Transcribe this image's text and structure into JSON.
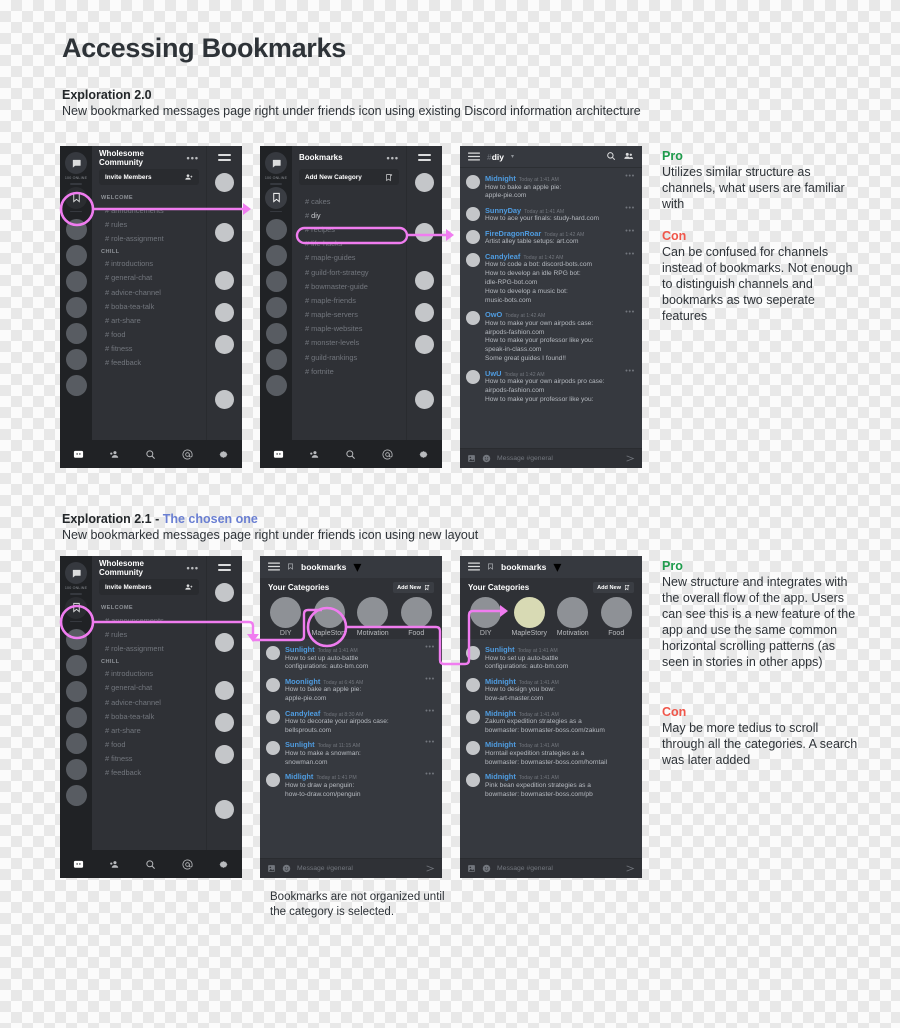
{
  "title": "Accessing Bookmarks",
  "explorations": [
    {
      "heading": "Exploration 2.0",
      "subtitle": "New bookmarked messages page right under friends icon using existing Discord information architecture",
      "pro_label": "Pro",
      "pro_text": "Utilizes similar structure as channels, what users are familiar with",
      "con_label": "Con",
      "con_text": "Can be confused for channels instead of bookmarks. Not enough to distinguish channels and bookmarks as two seperate features"
    },
    {
      "heading": "Exploration 2.1 - ",
      "heading_accent": "The chosen one",
      "subtitle": "New bookmarked messages page right under friends icon using new layout",
      "pro_label": "Pro",
      "pro_text": "New structure and integrates with the overall flow of the app. Users can see this is a new feature of the app and use the same common horizontal scrolling patterns (as seen in stories in other apps)",
      "con_label": "Con",
      "con_text": "May be more tedius to scroll through all the categories. A search was later added",
      "caption": "Bookmarks are not organized until the category is selected."
    }
  ],
  "colors": {
    "accent_magenta": "#f07cf0",
    "pro_green": "#1e9b4c",
    "con_red": "#f0564a",
    "chosen_blue": "#6a7fd2",
    "username_blue": "#4f9ce0",
    "selected_category": "#d8dab4"
  },
  "rail": {
    "online_label": "100 ONLINE",
    "server_icon": "chat-bubble-icon",
    "bookmark_icon": "bookmark-icon"
  },
  "bottom_nav": [
    {
      "name": "discord-home-icon",
      "active": true
    },
    {
      "name": "friends-icon",
      "active": false
    },
    {
      "name": "search-icon",
      "active": false
    },
    {
      "name": "mentions-icon",
      "active": false
    },
    {
      "name": "settings-gear-icon",
      "active": false
    }
  ],
  "phone_server": {
    "title": "Wholesome Community",
    "overflow": "•••",
    "invite_label": "Invite Members",
    "invite_icon": "add-person-icon",
    "groups": [
      {
        "label": "WELCOME",
        "channels": [
          "announcements",
          "rules",
          "role-assignment"
        ]
      },
      {
        "label": "CHILL",
        "channels": [
          "introductions",
          "general-chat",
          "advice-channel",
          "boba-tea-talk",
          "art-share",
          "food",
          "fitness",
          "feedback"
        ]
      }
    ]
  },
  "phone_bookmarks": {
    "title": "Bookmarks",
    "overflow": "•••",
    "add_label": "Add New Category",
    "add_icon": "bookmark-plus-icon",
    "channels": [
      "cakes",
      "diy",
      "recipes",
      "life-hacks",
      "maple-guides",
      "guild-fort-strategy",
      "bowmaster-guide",
      "maple-friends",
      "maple-servers",
      "maple-websites",
      "monster-levels",
      "guild-rankings",
      "fortnite"
    ],
    "highlighted_channel": "diy"
  },
  "phone_diy": {
    "channel_name": "diy",
    "hash": "#",
    "caret": "▾",
    "search_icon": "search-icon",
    "members_icon": "members-icon",
    "messages": [
      {
        "user": "Midnight",
        "time": "Today at 1:41 AM",
        "lines": [
          "How to bake an apple pie:",
          "apple-pie.com"
        ]
      },
      {
        "user": "SunnyDay",
        "time": "Today at 1:41 AM",
        "lines": [
          "How to ace your finals: study-hard.com"
        ]
      },
      {
        "user": "FireDragonRoar",
        "time": "Today at 1:42 AM",
        "lines": [
          "Artist alley table setups: art.com"
        ]
      },
      {
        "user": "Candyleaf",
        "time": "Today at 1:42 AM",
        "lines": [
          "How to code a bot: discord-bots.com",
          "How to develop an idle RPG bot:",
          "idle-RPG-bot.com",
          "How to develop a music bot:",
          "music-bots.com"
        ]
      },
      {
        "user": "OwO",
        "time": "Today at 1:42 AM",
        "lines": [
          "How to make your own airpods case:",
          "airpods-fashion.com",
          "How to make your professor like you:",
          "speak-in-class.com",
          "Some great guides I found!!"
        ]
      },
      {
        "user": "UwU",
        "time": "Today at 1:42 AM",
        "lines": [
          "How to make your own airpods pro case:",
          "airpods-fashion.com",
          "How to make your professor like you:"
        ]
      }
    ],
    "composer": {
      "placeholder": "Message #general",
      "attach_icon": "attachment-icon",
      "emoji_icon": "emoji-icon",
      "send_icon": "send-icon"
    }
  },
  "phone_cat_all": {
    "title": "bookmarks",
    "title_icon": "bookmark-icon",
    "caret": "▾",
    "section_label": "Your Categories",
    "add_label": "Add New",
    "add_icon": "bookmark-plus-icon",
    "categories": [
      {
        "name": "DIY",
        "selected": false
      },
      {
        "name": "MapleStory",
        "selected": false
      },
      {
        "name": "Motivation",
        "selected": false
      },
      {
        "name": "Food",
        "selected": false
      }
    ],
    "messages": [
      {
        "user": "Sunlight",
        "time": "Today at 1:41 AM",
        "lines": [
          "How to set up auto-battle",
          "configurations: auto-bm.com"
        ]
      },
      {
        "user": "Moonlight",
        "time": "Today at 6:45 AM",
        "lines": [
          "How to bake an apple pie:",
          "apple-pie.com"
        ]
      },
      {
        "user": "Candyleaf",
        "time": "Today at 8:30 AM",
        "lines": [
          "How to decorate your airpods case:",
          "bellsprouts.com"
        ]
      },
      {
        "user": "Sunlight",
        "time": "Today at 11:15 AM",
        "lines": [
          "How to make a snowman:",
          "snowman.com"
        ]
      },
      {
        "user": "Midlight",
        "time": "Today at 1:41 PM",
        "lines": [
          "How to draw a penguin:",
          "how-to-draw.com/penguin"
        ]
      }
    ],
    "composer": {
      "placeholder": "Message #general",
      "attach_icon": "attachment-icon",
      "emoji_icon": "emoji-icon",
      "send_icon": "send-icon"
    }
  },
  "phone_cat_maple": {
    "title": "bookmarks",
    "title_icon": "bookmark-icon",
    "caret": "▾",
    "section_label": "Your Categories",
    "add_label": "Add New",
    "add_icon": "bookmark-plus-icon",
    "categories": [
      {
        "name": "DIY",
        "selected": false
      },
      {
        "name": "MapleStory",
        "selected": true
      },
      {
        "name": "Motivation",
        "selected": false
      },
      {
        "name": "Food",
        "selected": false
      }
    ],
    "messages": [
      {
        "user": "Sunlight",
        "time": "Today at 1:41 AM",
        "lines": [
          "How to set up auto-battle",
          "configurations: auto-bm.com"
        ]
      },
      {
        "user": "Midnight",
        "time": "Today at 1:41 AM",
        "lines": [
          "How to design you bow:",
          "bow-art-master.com"
        ]
      },
      {
        "user": "Midnight",
        "time": "Today at 1:41 AM",
        "lines": [
          "Zakum expedition strategies as a",
          "bowmaster: bowmaster-boss.com/zakum"
        ]
      },
      {
        "user": "Midnight",
        "time": "Today at 1:41 AM",
        "lines": [
          "Horntail expedition strategies as a",
          "bowmaster: bowmaster-boss.com/horntail"
        ]
      },
      {
        "user": "Midnight",
        "time": "Today at 1:41 AM",
        "lines": [
          "Pink bean expedition strategies as a",
          "bowmaster: bowmaster-boss.com/pb"
        ]
      }
    ],
    "composer": {
      "placeholder": "Message #general",
      "attach_icon": "attachment-icon",
      "emoji_icon": "emoji-icon",
      "send_icon": "send-icon"
    }
  }
}
